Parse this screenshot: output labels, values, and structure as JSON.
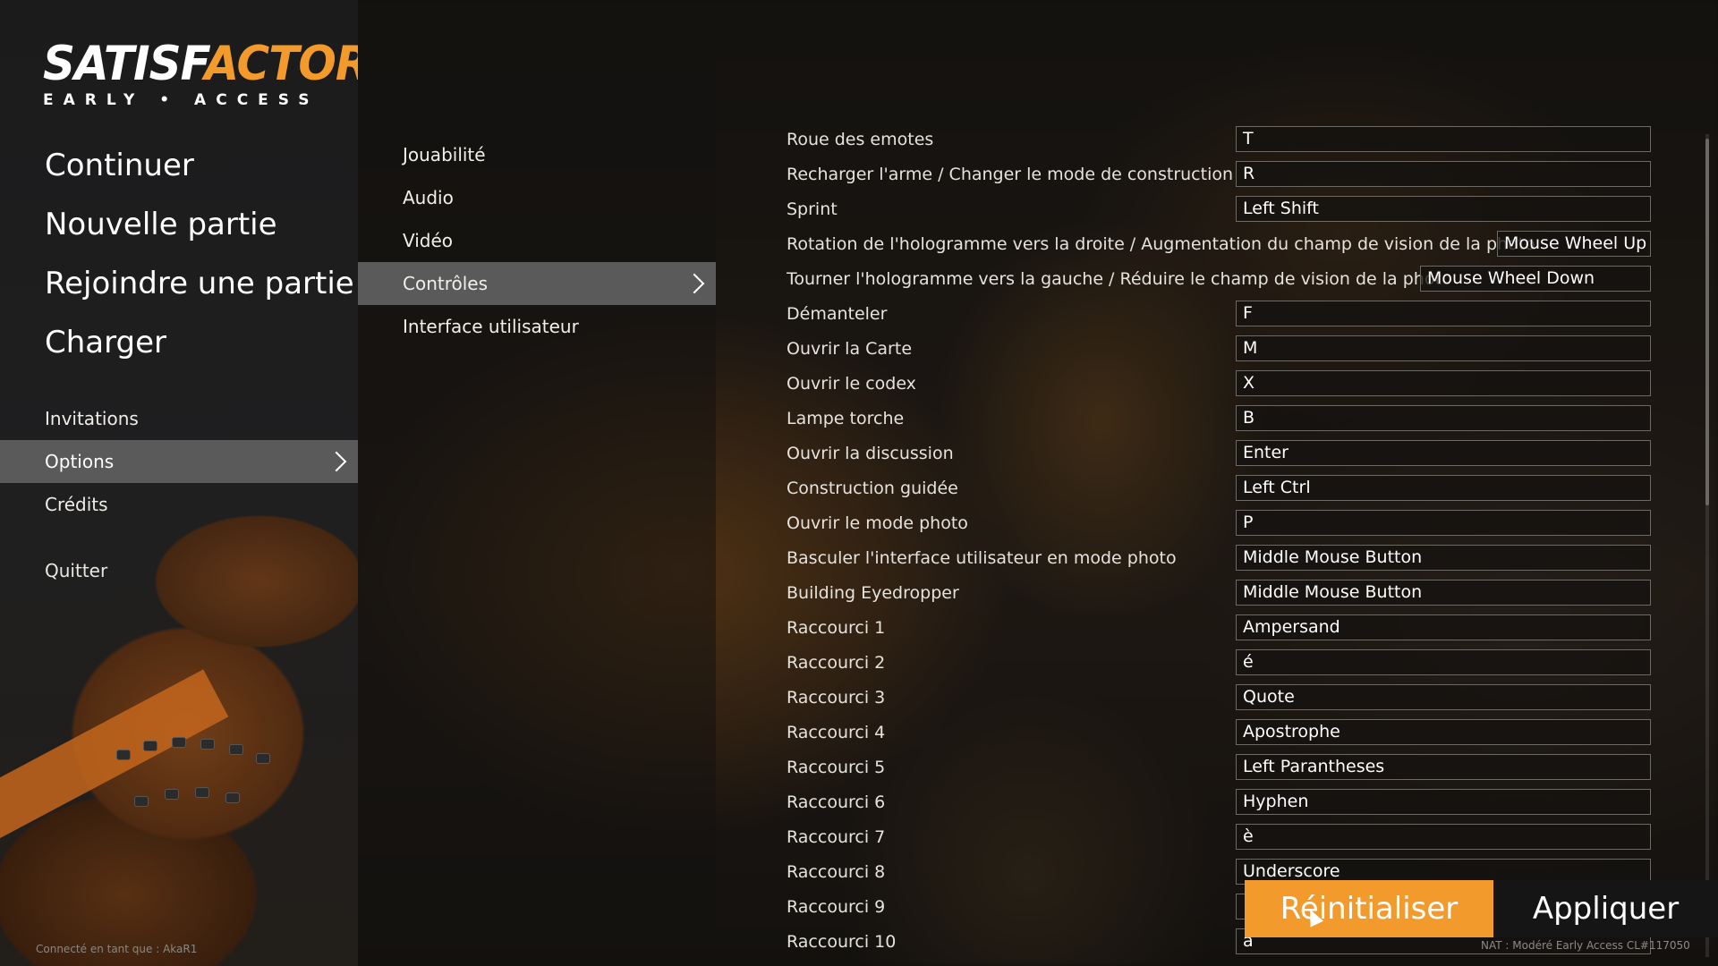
{
  "logo": {
    "main_a": "SATISF",
    "main_b": "ACTORY",
    "sub": "EARLY • ACCESS"
  },
  "main_menu": [
    "Continuer",
    "Nouvelle partie",
    "Rejoindre une partie",
    "Charger"
  ],
  "sub_menu": [
    "Invitations",
    "Options",
    "Crédits"
  ],
  "active_sub": "Options",
  "quit": "Quitter",
  "logged_in": "Connecté en tant que : AkaR1",
  "categories": [
    "Jouabilité",
    "Audio",
    "Vidéo",
    "Contrôles",
    "Interface utilisateur"
  ],
  "active_category": "Contrôles",
  "bindings": [
    {
      "label": "Roue des emotes",
      "key": "T"
    },
    {
      "label": "Recharger l'arme / Changer le mode de construction",
      "key": "R"
    },
    {
      "label": "Sprint",
      "key": "Left Shift"
    },
    {
      "label": "Rotation de l'hologramme vers la droite / Augmentation du champ de vision de la photo",
      "key": "Mouse Wheel Up"
    },
    {
      "label": "Tourner l'hologramme vers la gauche / Réduire le champ de vision de la photo",
      "key": "Mouse Wheel Down"
    },
    {
      "label": "Démanteler",
      "key": "F"
    },
    {
      "label": "Ouvrir la Carte",
      "key": "M"
    },
    {
      "label": "Ouvrir le codex",
      "key": "X"
    },
    {
      "label": "Lampe torche",
      "key": "B"
    },
    {
      "label": "Ouvrir la discussion",
      "key": "Enter"
    },
    {
      "label": "Construction guidée",
      "key": "Left Ctrl"
    },
    {
      "label": "Ouvrir le mode photo",
      "key": "P"
    },
    {
      "label": "Basculer l'interface utilisateur en mode photo",
      "key": "Middle Mouse Button"
    },
    {
      "label": "Building Eyedropper",
      "key": "Middle Mouse Button"
    },
    {
      "label": "Raccourci 1",
      "key": "Ampersand"
    },
    {
      "label": "Raccourci 2",
      "key": "é"
    },
    {
      "label": "Raccourci 3",
      "key": "Quote"
    },
    {
      "label": "Raccourci 4",
      "key": "Apostrophe"
    },
    {
      "label": "Raccourci 5",
      "key": "Left Parantheses"
    },
    {
      "label": "Raccourci 6",
      "key": "Hyphen"
    },
    {
      "label": "Raccourci 7",
      "key": "è"
    },
    {
      "label": "Raccourci 8",
      "key": "Underscore"
    },
    {
      "label": "Raccourci 9",
      "key": ""
    },
    {
      "label": "Raccourci 10",
      "key": "à"
    }
  ],
  "buttons": {
    "reset": "Réinitialiser",
    "apply": "Appliquer"
  },
  "version": "NAT : Modéré Early Access CL#117050",
  "colors": {
    "accent": "#f39a2c",
    "selected_bg": "#5a5a5b"
  }
}
